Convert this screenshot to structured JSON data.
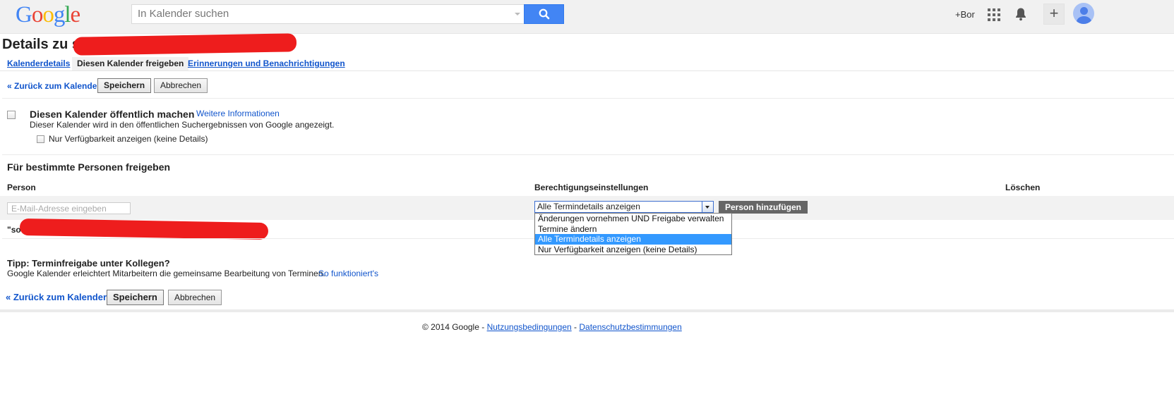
{
  "header": {
    "logo": [
      "G",
      "o",
      "o",
      "g",
      "l",
      "e"
    ],
    "search_placeholder": "In Kalender suchen",
    "user_link": "+Bor",
    "share_glyph": "+"
  },
  "page": {
    "title": "Details zu s"
  },
  "tabs": [
    {
      "label": "Kalenderdetails"
    },
    {
      "label": "Diesen Kalender freigeben"
    },
    {
      "label": "Erinnerungen und Benachrichtigungen"
    }
  ],
  "actions": {
    "back": "« Zurück zum Kalender",
    "save": "Speichern",
    "cancel": "Abbrechen"
  },
  "public": {
    "title": "Diesen Kalender öffentlich machen",
    "more_info": "Weitere Informationen",
    "description": "Dieser Kalender wird in den öffentlichen Suchergebnissen von Google angezeigt.",
    "availability_only": "Nur Verfügbarkeit anzeigen (keine Details)"
  },
  "sharing": {
    "title": "Für bestimmte Personen freigeben",
    "col_person": "Person",
    "col_permission": "Berechtigungseinstellungen",
    "col_delete": "Löschen",
    "email_placeholder": "E-Mail-Adresse eingeben",
    "selected_permission": "Alle Termindetails anzeigen",
    "add_button": "Person hinzufügen",
    "existing_person_prefix": "\"so",
    "options": [
      "Änderungen vornehmen UND Freigabe verwalten",
      "Termine ändern",
      "Alle Termindetails anzeigen",
      "Nur Verfügbarkeit anzeigen (keine Details)"
    ],
    "selected_option_index": 2
  },
  "tip": {
    "title": "Tipp: Terminfreigabe unter Kollegen?",
    "text": "Google Kalender erleichtert Mitarbeitern die gemeinsame Bearbeitung von Terminen.",
    "link": "So funktioniert's"
  },
  "footer": {
    "copyright": "© 2014 Google - ",
    "terms": "Nutzungsbedingungen",
    "separator": " - ",
    "privacy": "Datenschutzbestimmungen"
  },
  "colors": {
    "link": "#1155cc",
    "search_button": "#4285f4",
    "redaction": "#ee1d1d",
    "selected_option": "#3399ff"
  },
  "icons": [
    "search-icon",
    "apps-grid-icon",
    "notification-bell-icon",
    "add-share-icon",
    "avatar-icon",
    "dropdown-arrow-icon"
  ]
}
